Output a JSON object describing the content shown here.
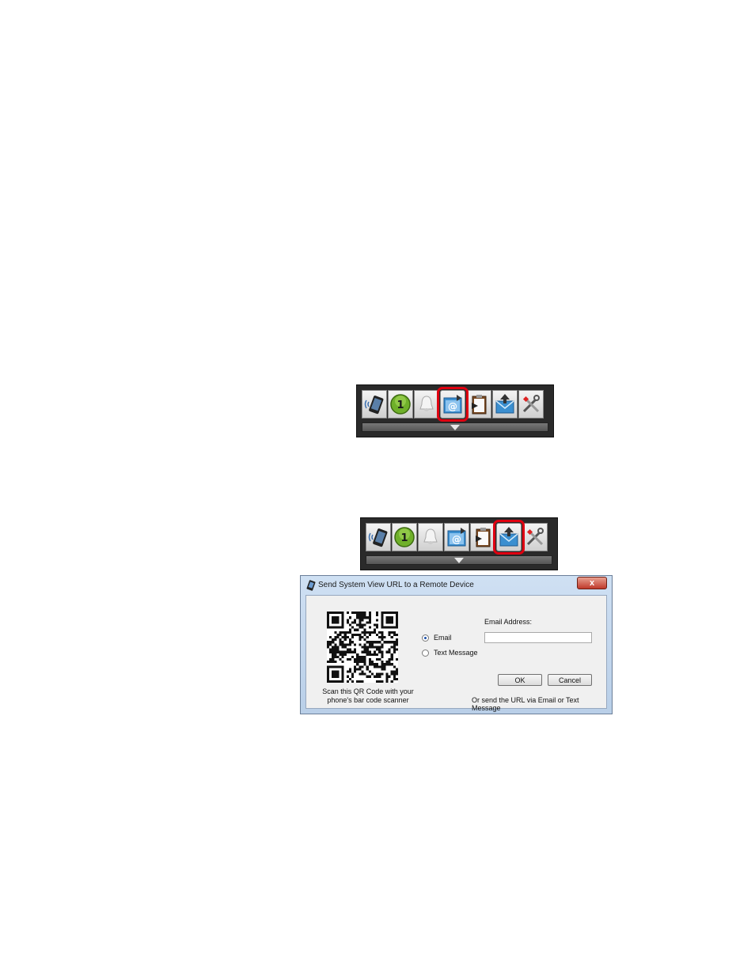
{
  "toolbars": [
    {
      "highlighted": "at-folder-icon",
      "buttons": [
        "phone-wireless-icon",
        "green-badge-icon",
        "bell-icon",
        "at-folder-icon",
        "clipboard-icon",
        "email-upload-icon",
        "tools-icon"
      ]
    },
    {
      "highlighted": "email-upload-icon",
      "buttons": [
        "phone-wireless-icon",
        "green-badge-icon",
        "bell-icon",
        "at-folder-icon",
        "clipboard-icon",
        "email-upload-icon",
        "tools-icon"
      ]
    }
  ],
  "toolbar_badge_number": "1",
  "highlight_color": "#e00010",
  "dialog": {
    "title": "Send System View URL to a Remote Device",
    "close_glyph": "x",
    "qr_caption_line1": "Scan this QR Code with your",
    "qr_caption_line2": "phone's bar code scanner",
    "options": [
      {
        "label": "Email",
        "selected": true
      },
      {
        "label": "Text Message",
        "selected": false
      }
    ],
    "email_label": "Email Address:",
    "email_value": "",
    "ok_label": "OK",
    "cancel_label": "Cancel",
    "footer": "Or send the URL via Email or Text Message"
  }
}
